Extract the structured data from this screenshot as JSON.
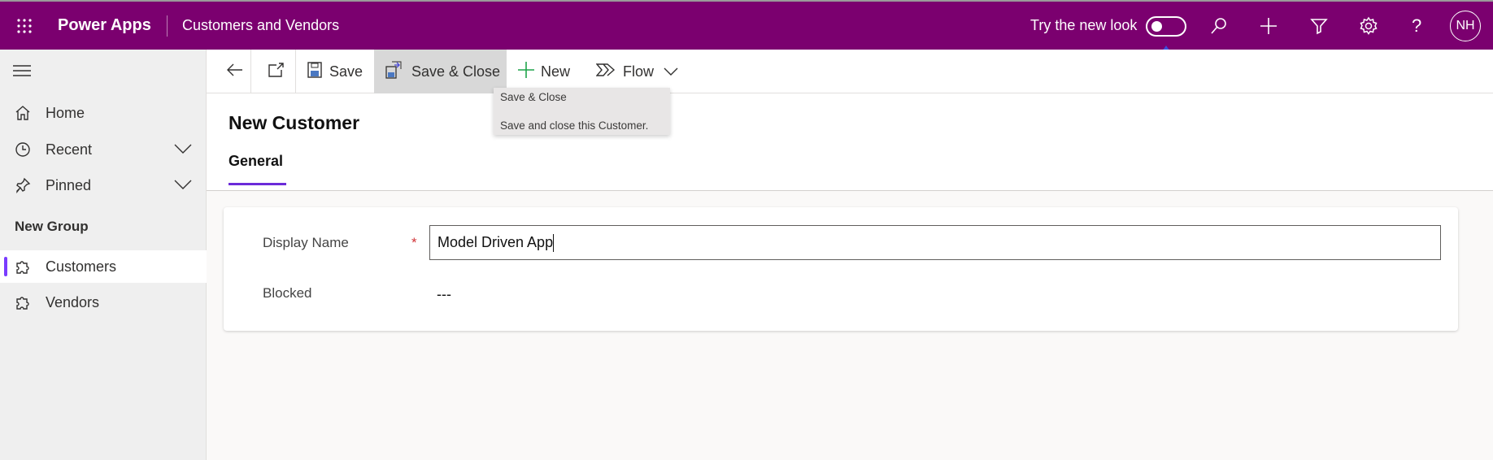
{
  "topbar": {
    "app_name": "Power Apps",
    "app_title": "Customers and Vendors",
    "try_new_look": "Try the new look",
    "new_look_enabled": false,
    "avatar_initials": "NH",
    "brand_color": "#7b006f"
  },
  "sidebar": {
    "items": [
      {
        "label": "Home"
      },
      {
        "label": "Recent"
      },
      {
        "label": "Pinned"
      }
    ],
    "group_label": "New Group",
    "group_items": [
      {
        "label": "Customers",
        "selected": true
      },
      {
        "label": "Vendors"
      }
    ]
  },
  "toolbar": {
    "save": "Save",
    "save_close": "Save & Close",
    "new": "New",
    "flow": "Flow"
  },
  "tooltip": {
    "title": "Save & Close",
    "description": "Save and close this Customer."
  },
  "form": {
    "title": "New Customer",
    "tabs": [
      {
        "label": "General",
        "active": true
      }
    ],
    "fields": [
      {
        "label": "Display Name",
        "required": "*",
        "value": "Model Driven App"
      },
      {
        "label": "Blocked",
        "value": "---"
      }
    ]
  }
}
